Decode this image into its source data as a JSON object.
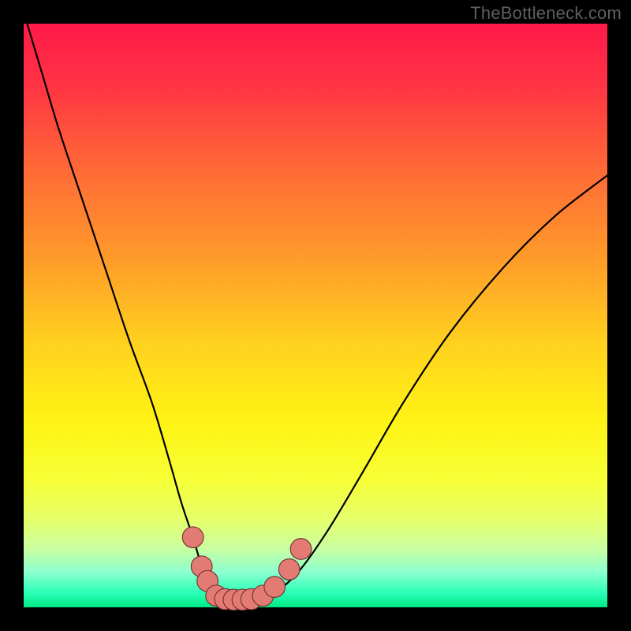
{
  "watermark": "TheBottleneck.com",
  "colors": {
    "frame_bg": "#000000",
    "gradient_stops": [
      {
        "offset": 0.0,
        "color": "#ff1a49"
      },
      {
        "offset": 0.1,
        "color": "#ff3144"
      },
      {
        "offset": 0.25,
        "color": "#ff6a36"
      },
      {
        "offset": 0.4,
        "color": "#ff9a2a"
      },
      {
        "offset": 0.55,
        "color": "#ffd21e"
      },
      {
        "offset": 0.68,
        "color": "#fff314"
      },
      {
        "offset": 0.78,
        "color": "#f7ff35"
      },
      {
        "offset": 0.85,
        "color": "#e6ff6b"
      },
      {
        "offset": 0.9,
        "color": "#c8ffa2"
      },
      {
        "offset": 0.94,
        "color": "#8cffcf"
      },
      {
        "offset": 0.975,
        "color": "#2bffb7"
      },
      {
        "offset": 1.0,
        "color": "#00e884"
      }
    ],
    "curve": "#000000",
    "marker_fill": "#e37b75",
    "marker_stroke": "#6b2f2b"
  },
  "chart_data": {
    "type": "line",
    "title": "",
    "xlabel": "",
    "ylabel": "",
    "xlim": [
      0,
      100
    ],
    "ylim": [
      0,
      100
    ],
    "note": "Axes have no visible tick labels; x/y are in percent of plot area. y=0 is bottom (green).",
    "series": [
      {
        "name": "bottleneck-curve",
        "x": [
          0,
          3,
          6,
          10,
          14,
          18,
          22,
          25,
          27,
          29,
          30.5,
          32,
          33.5,
          35,
          37,
          40,
          43,
          47,
          52,
          58,
          65,
          73,
          82,
          91,
          100
        ],
        "y": [
          102,
          92,
          82,
          70,
          58,
          46,
          35,
          25,
          18,
          12,
          7,
          3,
          1.5,
          1.2,
          1.2,
          1.4,
          2.5,
          6,
          13,
          23,
          35,
          47,
          58,
          67,
          74
        ]
      }
    ],
    "markers": {
      "name": "highlighted-range",
      "points": [
        {
          "x": 29.0,
          "y": 12.0
        },
        {
          "x": 30.5,
          "y": 7.0
        },
        {
          "x": 31.5,
          "y": 4.5
        },
        {
          "x": 33.0,
          "y": 2.0
        },
        {
          "x": 34.5,
          "y": 1.4
        },
        {
          "x": 36.0,
          "y": 1.3
        },
        {
          "x": 37.5,
          "y": 1.3
        },
        {
          "x": 39.0,
          "y": 1.4
        },
        {
          "x": 41.0,
          "y": 2.0
        },
        {
          "x": 43.0,
          "y": 3.5
        },
        {
          "x": 45.5,
          "y": 6.5
        },
        {
          "x": 47.5,
          "y": 10.0
        }
      ],
      "radius_pct": 1.8
    }
  }
}
